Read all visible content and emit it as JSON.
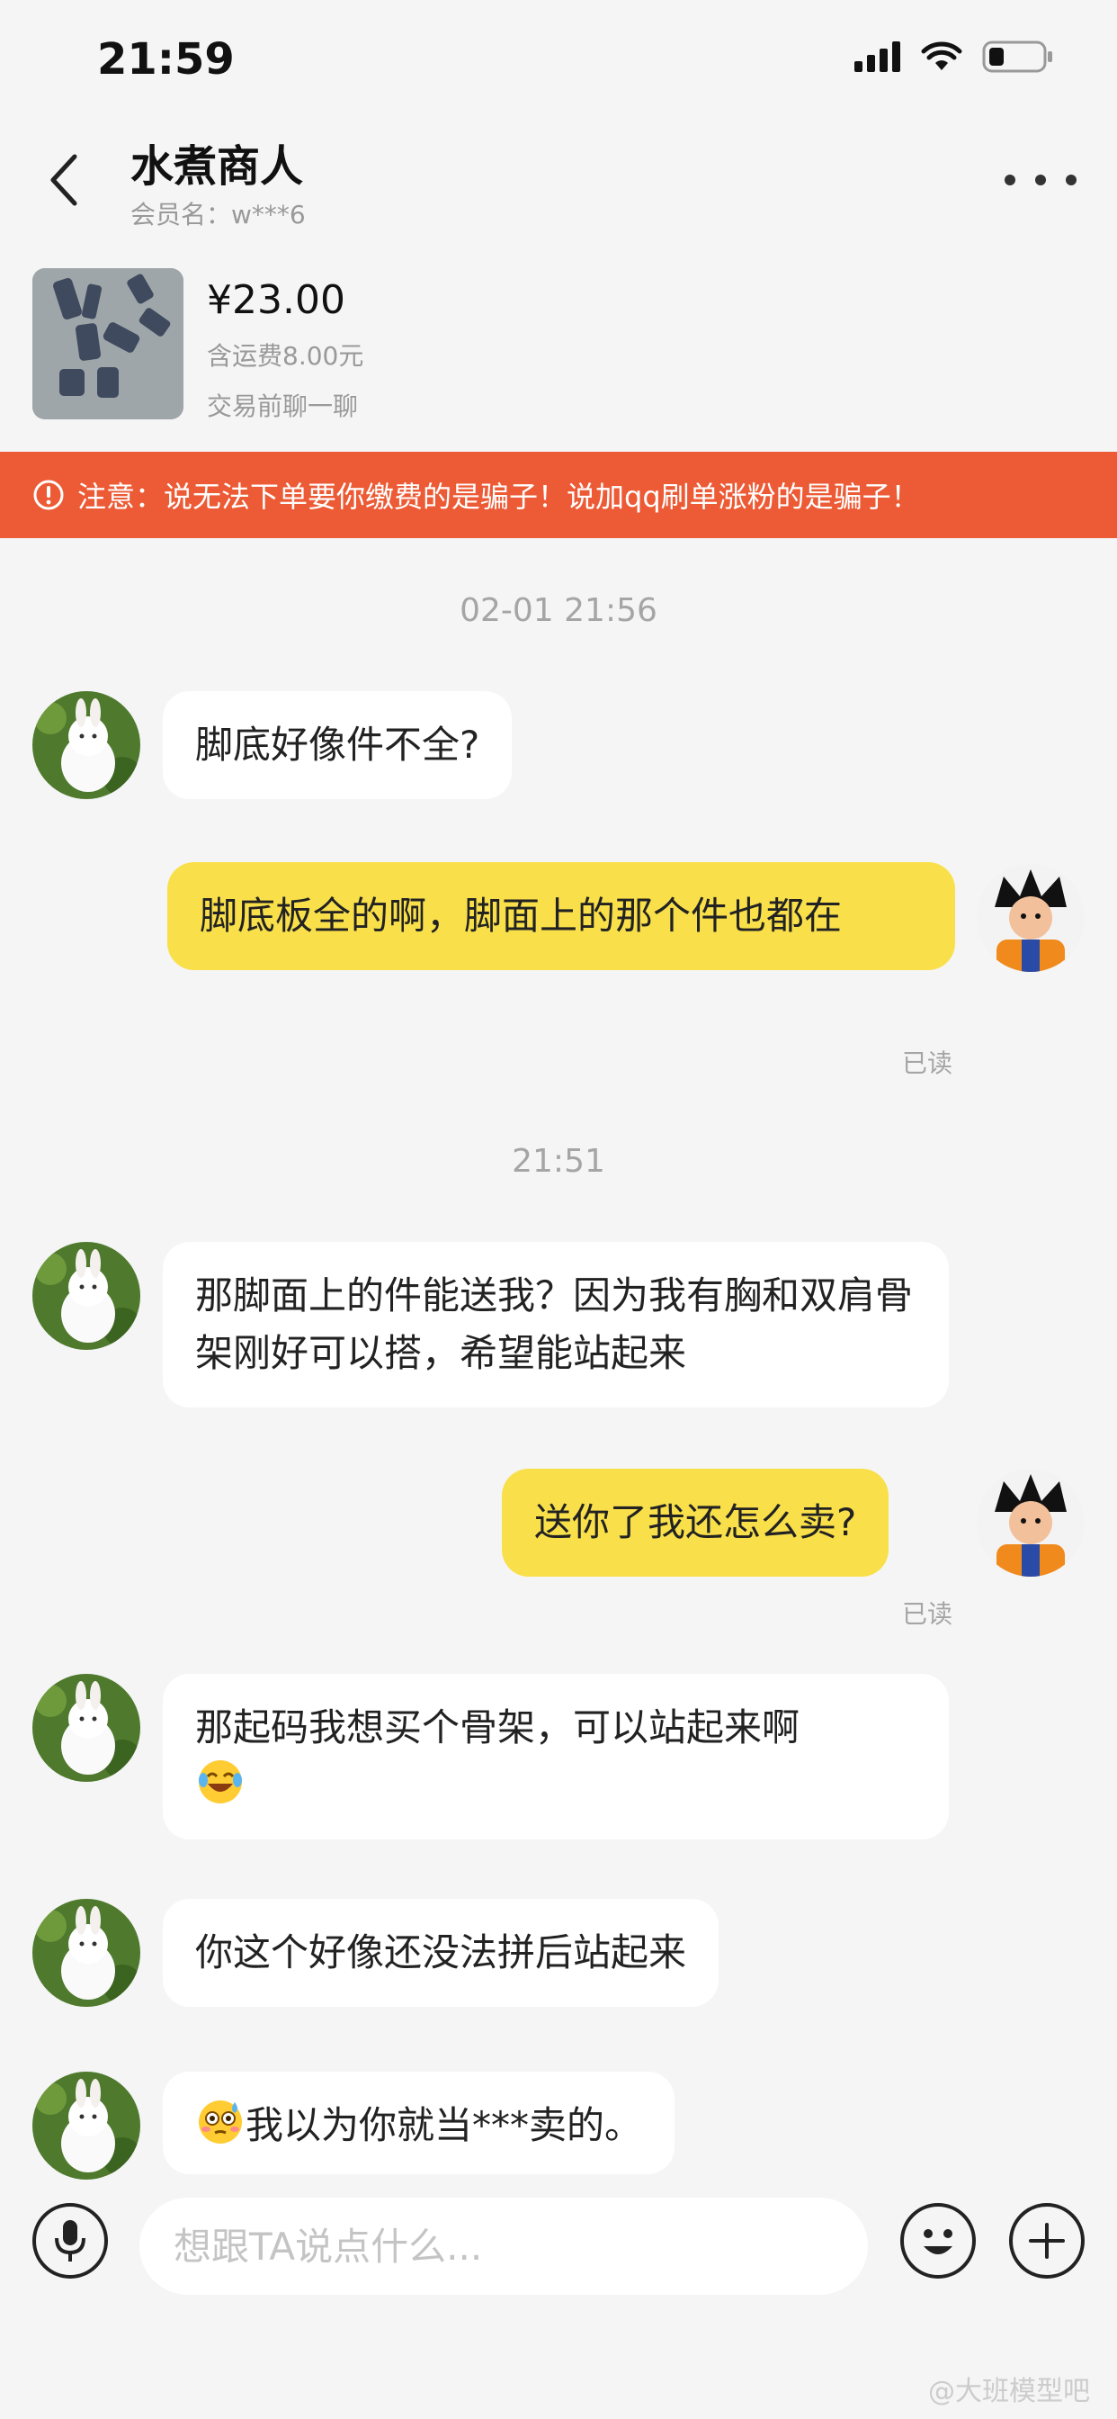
{
  "status_bar": {
    "time": "21:59"
  },
  "header": {
    "shop_name": "水煮商人",
    "member_name": "会员名：w***6"
  },
  "product": {
    "price": "¥23.00",
    "shipping": "含运费8.00元",
    "chat_hint": "交易前聊一聊"
  },
  "warning": {
    "text": "注意：说无法下单要你缴费的是骗子！说加qq刷单涨粉的是骗子！"
  },
  "chat": {
    "timestamps": [
      "02-01 21:56",
      "21:51"
    ],
    "messages": [
      {
        "side": "left",
        "text": "脚底好像件不全?"
      },
      {
        "side": "right",
        "text": "脚底板全的啊，脚面上的那个件也都在",
        "status": "已读"
      },
      {
        "side": "left",
        "text": "那脚面上的件能送我？因为我有胸和双肩骨架刚好可以搭，希望能站起来"
      },
      {
        "side": "right",
        "text": "送你了我还怎么卖?",
        "status": "已读"
      },
      {
        "side": "left",
        "text": "那起码我想买个骨架，可以站起来啊",
        "emoji": "laugh-cry-emoji"
      },
      {
        "side": "left",
        "text": "你这个好像还没法拼后站起来"
      },
      {
        "side": "left",
        "text": "我以为你就当***卖的。",
        "emoji": "flushed-emoji"
      }
    ]
  },
  "input": {
    "placeholder": "想跟TA说点什么..."
  },
  "watermark": "@大班模型吧",
  "colors": {
    "warning": "#ec5b35",
    "own_bubble": "#f9e04b",
    "background": "#f5f5f5"
  }
}
